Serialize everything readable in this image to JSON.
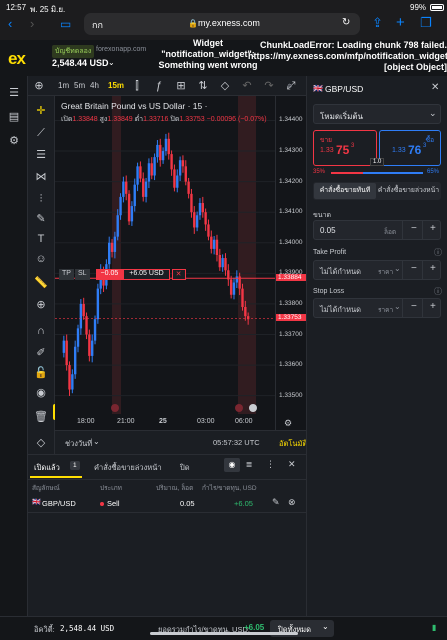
{
  "status": {
    "time": "12:57",
    "date": "พ. 25 มิ.ย.",
    "battery": "99%"
  },
  "browser": {
    "tab_label": "กก",
    "url": "my.exness.com"
  },
  "header": {
    "account_type": "บัญชีทดลอง",
    "server": "forexonapp.com",
    "balance": "2,548.44 USD",
    "widget_error": "Widget \"notification_widget\": Something went wrong",
    "chunk_error": "ChunkLoadError: Loading chunk 798 failed. https://my.exness.com/mfp/notification_widget/... [object Object]"
  },
  "chart_toolbar": {
    "timeframes": [
      "1m",
      "5m",
      "4h",
      "15m"
    ],
    "active_timeframe": "15m"
  },
  "chart": {
    "title": "Great Britain Pound vs US Dollar · 15 ·",
    "ohlc": {
      "open_label": "เปิด",
      "open": "1.33848",
      "high_label": "สูง",
      "high": "1.33849",
      "low_label": "ต่ำ",
      "low": "1.33716",
      "close_label": "ปิด",
      "close": "1.33753",
      "change": "−0.00096 (−0.07%)"
    },
    "position_line": {
      "tp": "TP",
      "sl": "SL",
      "pnl": "−0.05",
      "volume": "+6.05 USD",
      "close": "✕"
    },
    "price_ticks": [
      "1.34400",
      "1.34300",
      "1.34200",
      "1.34100",
      "1.34000",
      "1.33900",
      "1.33800",
      "1.33700",
      "1.33600",
      "1.33500"
    ],
    "current_price": "1.33753",
    "position_price": "1.33884",
    "time_ticks": [
      "18:00",
      "21:00",
      "25",
      "03:00",
      "06:00"
    ],
    "range_label": "ช่วงวันที่",
    "clock": "05:57:32 UTC",
    "auto_label": "อัตโนมัติ",
    "colors": {
      "up": "#2f7df6",
      "down": "#f23645",
      "bg": "#131519"
    }
  },
  "right_panel": {
    "symbol": "GBP/USD",
    "mode": "โหมดเริ่มต้น",
    "sell": {
      "label": "ขาย",
      "price_prefix": "1.33",
      "price_big": "75",
      "price_sup": "3"
    },
    "buy": {
      "label": "ซื้อ",
      "price_prefix": "1.33",
      "price_big": "76",
      "price_sup": "3"
    },
    "spread": "1.0",
    "sentiment_sell": "35%",
    "sentiment_buy": "65%",
    "sentiment_sell_fraction": 0.35,
    "order_tabs": [
      "คำสั่งซื้อขายทันที",
      "คำสั่งซื้อขายล่วงหน้า"
    ],
    "volume_label": "ขนาด",
    "volume_value": "0.05",
    "volume_unit": "ล็อต",
    "tp_label": "Take Profit",
    "tp_value": "ไม่ได้กำหนด",
    "tp_unit": "ราคา",
    "sl_label": "Stop Loss",
    "sl_value": "ไม่ได้กำหนด",
    "sl_unit": "ราคา"
  },
  "bottom_panel": {
    "tabs": [
      {
        "label": "เปิดแล้ว",
        "count": "1"
      },
      {
        "label": "คำสั่งซื้อขายล่วงหน้า"
      },
      {
        "label": "ปิด"
      }
    ],
    "columns": [
      "สัญลักษณ์",
      "ประเภท",
      "ปริมาณ, ล็อต",
      "กำไร/ขาดทุน, USD"
    ],
    "rows": [
      {
        "symbol": "GBP/USD",
        "type": "Sell",
        "volume": "0.05",
        "pnl": "+6.05"
      }
    ]
  },
  "footer": {
    "equity_label": "อิควิตี้:",
    "equity": "2,548.44 USD",
    "total_pnl_label": "ยอดรวมกำไร/ขาดทุน, USD:",
    "total_pnl": "+6.05",
    "close_all": "ปิดทั้งหมด"
  }
}
